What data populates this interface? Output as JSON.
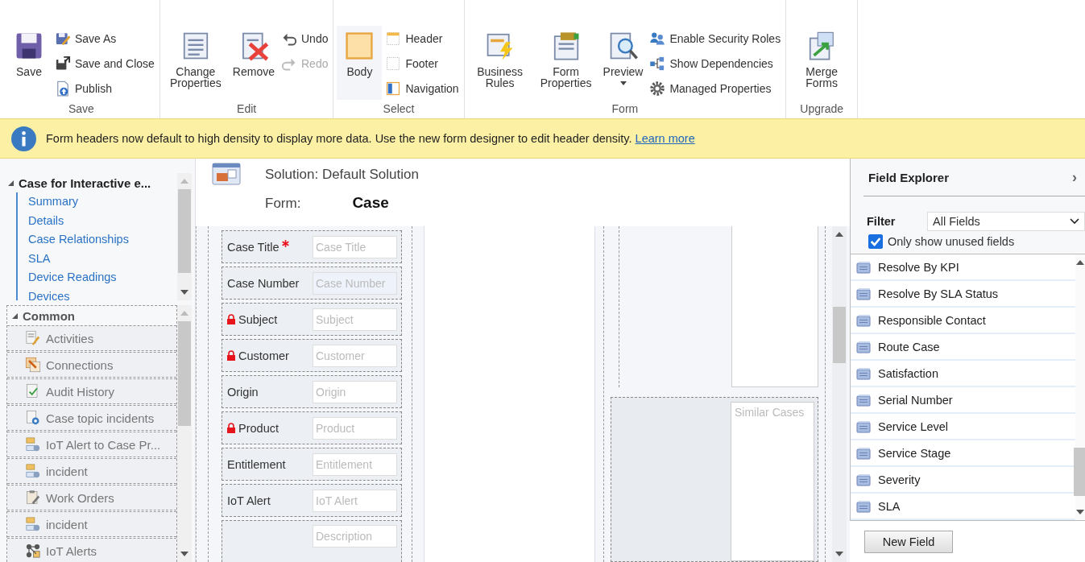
{
  "ribbon": {
    "groups": [
      {
        "label": "Save",
        "items": [
          {
            "kind": "large",
            "label": "Save",
            "disabled": false
          },
          {
            "kind": "small",
            "label": "Save As",
            "disabled": false
          },
          {
            "kind": "small",
            "label": "Save and Close",
            "disabled": false
          },
          {
            "kind": "small",
            "label": "Publish",
            "disabled": false
          }
        ]
      },
      {
        "label": "Edit",
        "items": [
          {
            "kind": "large",
            "label": "Change Properties",
            "disabled": false
          },
          {
            "kind": "large",
            "label": "Remove",
            "disabled": false
          },
          {
            "kind": "small",
            "label": "Undo",
            "disabled": false
          },
          {
            "kind": "small",
            "label": "Redo",
            "disabled": true
          }
        ]
      },
      {
        "label": "Select",
        "items": [
          {
            "kind": "large",
            "label": "Body",
            "disabled": false,
            "selected": true
          },
          {
            "kind": "small",
            "label": "Header",
            "disabled": false,
            "selected": false
          },
          {
            "kind": "small",
            "label": "Footer",
            "disabled": false,
            "selected": false
          },
          {
            "kind": "small",
            "label": "Navigation",
            "disabled": false,
            "selected": false
          }
        ]
      },
      {
        "label": "Form",
        "items": [
          {
            "kind": "large",
            "label": "Business Rules",
            "disabled": false
          },
          {
            "kind": "large",
            "label": "Form Properties",
            "disabled": false
          },
          {
            "kind": "large",
            "label": "Preview",
            "disabled": false,
            "dropdown": true
          },
          {
            "kind": "small",
            "label": "Enable Security Roles",
            "disabled": false
          },
          {
            "kind": "small",
            "label": "Show Dependencies",
            "disabled": false
          },
          {
            "kind": "small",
            "label": "Managed Properties",
            "disabled": false
          }
        ]
      },
      {
        "label": "Upgrade",
        "items": [
          {
            "kind": "large",
            "label": "Merge Forms",
            "disabled": false
          }
        ]
      }
    ]
  },
  "notification": {
    "text": "Form headers now default to high density to display more data. Use the new form designer to edit header density.",
    "link": "Learn more"
  },
  "navigation": {
    "tree": {
      "label": "Case for Interactive e...",
      "expanded": true,
      "children": [
        "Summary",
        "Details",
        "Case Relationships",
        "SLA",
        "Device Readings",
        "Devices"
      ]
    },
    "common": {
      "label": "Common",
      "expanded": true,
      "items": [
        "Activities",
        "Connections",
        "Audit History",
        "Case topic incidents",
        "IoT Alert to Case Pr...",
        "incident",
        "Work Orders",
        "incident",
        "IoT Alerts"
      ]
    }
  },
  "header": {
    "solution": "Solution: Default Solution",
    "form_label": "Form:",
    "form_name": "Case"
  },
  "form": {
    "fields": [
      {
        "label": "Case Title",
        "placeholder": "Case Title",
        "required": true,
        "locked": false,
        "read_only": false
      },
      {
        "label": "Case Number",
        "placeholder": "Case Number",
        "required": false,
        "locked": false,
        "read_only": true
      },
      {
        "label": "Subject",
        "placeholder": "Subject",
        "required": false,
        "locked": true,
        "read_only": false
      },
      {
        "label": "Customer",
        "placeholder": "Customer",
        "required": false,
        "locked": true,
        "read_only": false
      },
      {
        "label": "Origin",
        "placeholder": "Origin",
        "required": false,
        "locked": false,
        "read_only": false
      },
      {
        "label": "Product",
        "placeholder": "Product",
        "required": false,
        "locked": true,
        "read_only": false
      },
      {
        "label": "Entitlement",
        "placeholder": "Entitlement",
        "required": false,
        "locked": false,
        "read_only": false
      },
      {
        "label": "IoT Alert",
        "placeholder": "IoT Alert",
        "required": false,
        "locked": false,
        "read_only": false
      },
      {
        "placeholder": "Description",
        "required": false,
        "locked": false,
        "read_only": false
      }
    ],
    "subgrid": "Similar Cases"
  },
  "field_explorer": {
    "title": "Field Explorer",
    "collapse": "›",
    "filter_label": "Filter",
    "filter_value": "All Fields",
    "unused_only": {
      "label": "Only show unused fields",
      "checked": true
    },
    "fields": [
      "Resolve By KPI",
      "Resolve By SLA Status",
      "Responsible Contact",
      "Route Case",
      "Satisfaction",
      "Serial Number",
      "Service Level",
      "Service Stage",
      "Severity",
      "SLA"
    ],
    "new_field": "New Field"
  }
}
